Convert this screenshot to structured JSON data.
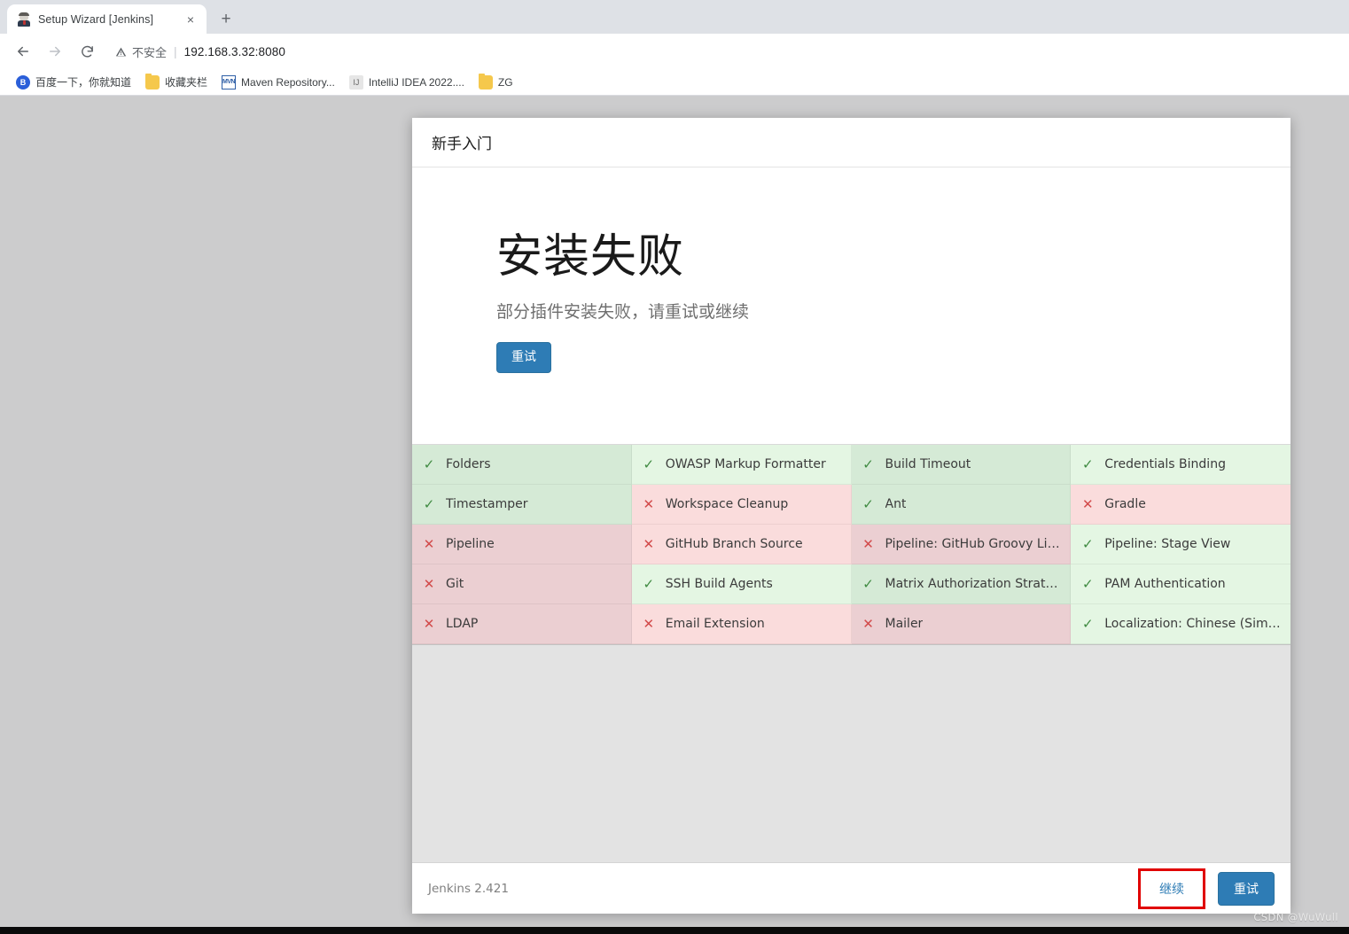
{
  "browser": {
    "tab": {
      "title": "Setup Wizard [Jenkins]",
      "favicon": "jenkins-butler-icon",
      "close_label": "×"
    },
    "new_tab_label": "+",
    "nav": {
      "back": "back-arrow",
      "forward": "forward-arrow",
      "reload": "reload-arrow"
    },
    "omnibox": {
      "security_label": "不安全",
      "separator": "|",
      "url": "192.168.3.32:8080"
    },
    "bookmarks": [
      {
        "label": "百度一下，你就知道",
        "icon": "baidu-icon"
      },
      {
        "label": "收藏夹栏",
        "icon": "folder-icon"
      },
      {
        "label": "Maven Repository...",
        "icon": "maven-icon"
      },
      {
        "label": "IntelliJ IDEA 2022....",
        "icon": "intellij-icon"
      },
      {
        "label": "ZG",
        "icon": "folder-icon"
      }
    ]
  },
  "wizard": {
    "header_title": "新手入门",
    "hero": {
      "heading": "安装失败",
      "subheading": "部分插件安装失败，请重试或继续",
      "retry_label": "重试"
    },
    "plugins": [
      {
        "name": "Folders",
        "status": "ok"
      },
      {
        "name": "OWASP Markup Formatter",
        "status": "ok"
      },
      {
        "name": "Build Timeout",
        "status": "ok"
      },
      {
        "name": "Credentials Binding",
        "status": "ok"
      },
      {
        "name": "Timestamper",
        "status": "ok"
      },
      {
        "name": "Workspace Cleanup",
        "status": "fail"
      },
      {
        "name": "Ant",
        "status": "ok"
      },
      {
        "name": "Gradle",
        "status": "fail"
      },
      {
        "name": "Pipeline",
        "status": "fail"
      },
      {
        "name": "GitHub Branch Source",
        "status": "fail"
      },
      {
        "name": "Pipeline: GitHub Groovy Libraries",
        "status": "fail"
      },
      {
        "name": "Pipeline: Stage View",
        "status": "ok"
      },
      {
        "name": "Git",
        "status": "fail"
      },
      {
        "name": "SSH Build Agents",
        "status": "ok"
      },
      {
        "name": "Matrix Authorization Strategy",
        "status": "ok"
      },
      {
        "name": "PAM Authentication",
        "status": "ok"
      },
      {
        "name": "LDAP",
        "status": "fail"
      },
      {
        "name": "Email Extension",
        "status": "fail"
      },
      {
        "name": "Mailer",
        "status": "fail"
      },
      {
        "name": "Localization: Chinese (Simplified)",
        "status": "ok"
      }
    ],
    "status_glyphs": {
      "ok": "✓",
      "fail": "✕"
    },
    "footer": {
      "version": "Jenkins 2.421",
      "continue_label": "继续",
      "retry_label": "重试"
    }
  },
  "colors": {
    "accent_blue": "#2e7cb5",
    "ok_dark": "#d5ead6",
    "ok_light": "#e4f6e3",
    "fail_dark": "#ebcfd2",
    "fail_light": "#fadcdc",
    "ok_mark": "#3f8a41",
    "fail_mark": "#d24a4a",
    "highlight_box": "#e00000",
    "page_bg": "#cccccd"
  },
  "watermark": "CSDN @WuWull"
}
